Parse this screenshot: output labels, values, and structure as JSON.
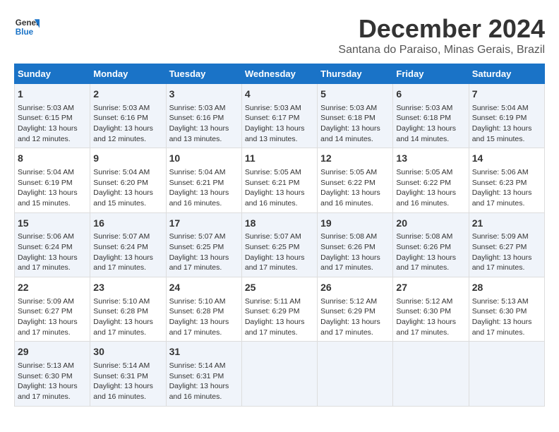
{
  "header": {
    "logo_line1": "General",
    "logo_line2": "Blue",
    "title": "December 2024",
    "subtitle": "Santana do Paraiso, Minas Gerais, Brazil"
  },
  "days_of_week": [
    "Sunday",
    "Monday",
    "Tuesday",
    "Wednesday",
    "Thursday",
    "Friday",
    "Saturday"
  ],
  "weeks": [
    [
      {
        "day": "1",
        "sunrise": "5:03 AM",
        "sunset": "6:15 PM",
        "daylight": "13 hours and 12 minutes."
      },
      {
        "day": "2",
        "sunrise": "5:03 AM",
        "sunset": "6:16 PM",
        "daylight": "13 hours and 12 minutes."
      },
      {
        "day": "3",
        "sunrise": "5:03 AM",
        "sunset": "6:16 PM",
        "daylight": "13 hours and 13 minutes."
      },
      {
        "day": "4",
        "sunrise": "5:03 AM",
        "sunset": "6:17 PM",
        "daylight": "13 hours and 13 minutes."
      },
      {
        "day": "5",
        "sunrise": "5:03 AM",
        "sunset": "6:18 PM",
        "daylight": "13 hours and 14 minutes."
      },
      {
        "day": "6",
        "sunrise": "5:03 AM",
        "sunset": "6:18 PM",
        "daylight": "13 hours and 14 minutes."
      },
      {
        "day": "7",
        "sunrise": "5:04 AM",
        "sunset": "6:19 PM",
        "daylight": "13 hours and 15 minutes."
      }
    ],
    [
      {
        "day": "8",
        "sunrise": "5:04 AM",
        "sunset": "6:19 PM",
        "daylight": "13 hours and 15 minutes."
      },
      {
        "day": "9",
        "sunrise": "5:04 AM",
        "sunset": "6:20 PM",
        "daylight": "13 hours and 15 minutes."
      },
      {
        "day": "10",
        "sunrise": "5:04 AM",
        "sunset": "6:21 PM",
        "daylight": "13 hours and 16 minutes."
      },
      {
        "day": "11",
        "sunrise": "5:05 AM",
        "sunset": "6:21 PM",
        "daylight": "13 hours and 16 minutes."
      },
      {
        "day": "12",
        "sunrise": "5:05 AM",
        "sunset": "6:22 PM",
        "daylight": "13 hours and 16 minutes."
      },
      {
        "day": "13",
        "sunrise": "5:05 AM",
        "sunset": "6:22 PM",
        "daylight": "13 hours and 16 minutes."
      },
      {
        "day": "14",
        "sunrise": "5:06 AM",
        "sunset": "6:23 PM",
        "daylight": "13 hours and 17 minutes."
      }
    ],
    [
      {
        "day": "15",
        "sunrise": "5:06 AM",
        "sunset": "6:24 PM",
        "daylight": "13 hours and 17 minutes."
      },
      {
        "day": "16",
        "sunrise": "5:07 AM",
        "sunset": "6:24 PM",
        "daylight": "13 hours and 17 minutes."
      },
      {
        "day": "17",
        "sunrise": "5:07 AM",
        "sunset": "6:25 PM",
        "daylight": "13 hours and 17 minutes."
      },
      {
        "day": "18",
        "sunrise": "5:07 AM",
        "sunset": "6:25 PM",
        "daylight": "13 hours and 17 minutes."
      },
      {
        "day": "19",
        "sunrise": "5:08 AM",
        "sunset": "6:26 PM",
        "daylight": "13 hours and 17 minutes."
      },
      {
        "day": "20",
        "sunrise": "5:08 AM",
        "sunset": "6:26 PM",
        "daylight": "13 hours and 17 minutes."
      },
      {
        "day": "21",
        "sunrise": "5:09 AM",
        "sunset": "6:27 PM",
        "daylight": "13 hours and 17 minutes."
      }
    ],
    [
      {
        "day": "22",
        "sunrise": "5:09 AM",
        "sunset": "6:27 PM",
        "daylight": "13 hours and 17 minutes."
      },
      {
        "day": "23",
        "sunrise": "5:10 AM",
        "sunset": "6:28 PM",
        "daylight": "13 hours and 17 minutes."
      },
      {
        "day": "24",
        "sunrise": "5:10 AM",
        "sunset": "6:28 PM",
        "daylight": "13 hours and 17 minutes."
      },
      {
        "day": "25",
        "sunrise": "5:11 AM",
        "sunset": "6:29 PM",
        "daylight": "13 hours and 17 minutes."
      },
      {
        "day": "26",
        "sunrise": "5:12 AM",
        "sunset": "6:29 PM",
        "daylight": "13 hours and 17 minutes."
      },
      {
        "day": "27",
        "sunrise": "5:12 AM",
        "sunset": "6:30 PM",
        "daylight": "13 hours and 17 minutes."
      },
      {
        "day": "28",
        "sunrise": "5:13 AM",
        "sunset": "6:30 PM",
        "daylight": "13 hours and 17 minutes."
      }
    ],
    [
      {
        "day": "29",
        "sunrise": "5:13 AM",
        "sunset": "6:30 PM",
        "daylight": "13 hours and 17 minutes."
      },
      {
        "day": "30",
        "sunrise": "5:14 AM",
        "sunset": "6:31 PM",
        "daylight": "13 hours and 16 minutes."
      },
      {
        "day": "31",
        "sunrise": "5:14 AM",
        "sunset": "6:31 PM",
        "daylight": "13 hours and 16 minutes."
      },
      null,
      null,
      null,
      null
    ]
  ],
  "labels": {
    "sunrise": "Sunrise:",
    "sunset": "Sunset:",
    "daylight": "Daylight:"
  }
}
